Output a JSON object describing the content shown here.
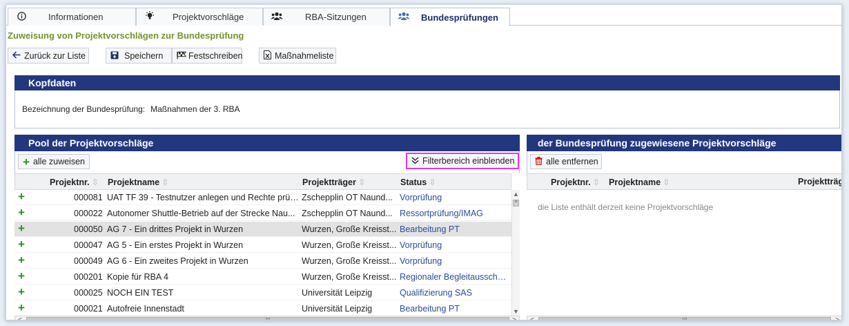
{
  "tabs": [
    {
      "label": "Informationen",
      "icon": "info-icon"
    },
    {
      "label": "Projektvorschläge",
      "icon": "lightbulb-icon"
    },
    {
      "label": "RBA-Sitzungen",
      "icon": "users-icon"
    },
    {
      "label": "Bundesprüfungen",
      "icon": "users-icon",
      "active": true
    }
  ],
  "page_title": "Zuweisung von Projektvorschlägen zur Bundesprüfung",
  "toolbar": {
    "back": "Zurück zur Liste",
    "save": "Speichern",
    "finalize": "Festschreiben",
    "measures": "Maßnahmeliste"
  },
  "kopfdaten": {
    "title": "Kopfdaten",
    "label": "Bezeichnung der Bundesprüfung:",
    "value": "Maßnahmen der 3. RBA"
  },
  "pool": {
    "title": "Pool der Projektvorschläge",
    "assign_all": "alle zuweisen",
    "filter_toggle": "Filterbereich einblenden",
    "columns": [
      "Projektnr.",
      "Projektname",
      "Projektträger",
      "Status"
    ],
    "rows": [
      {
        "nr": "000081",
        "name": "UAT TF 39 - Testnutzer anlegen und Rechte prüf...",
        "traeger": "Zschepplin OT Naund...",
        "status": "Vorprüfung"
      },
      {
        "nr": "000022",
        "name": "Autonomer Shuttle-Betrieb auf der Strecke Nau...",
        "traeger": "Zschepplin OT Naund...",
        "status": "Ressortprüfung/IMAG"
      },
      {
        "nr": "000050",
        "name": "AG 7 - Ein drittes Projekt in Wurzen",
        "traeger": "Wurzen, Große Kreisst...",
        "status": "Bearbeitung PT",
        "selected": true
      },
      {
        "nr": "000047",
        "name": "AG 5 - Ein erstes Projekt in Wurzen",
        "traeger": "Wurzen, Große Kreisst...",
        "status": "Vorprüfung"
      },
      {
        "nr": "000049",
        "name": "AG 6 - Ein zweites Projekt in Wurzen",
        "traeger": "Wurzen, Große Kreisst...",
        "status": "Vorprüfung"
      },
      {
        "nr": "000201",
        "name": "Kopie für RBA 4",
        "traeger": "Wurzen, Große Kreisst...",
        "status": "Regionaler Begleitausschuss"
      },
      {
        "nr": "000025",
        "name": "NOCH EIN TEST",
        "traeger": "Universität Leipzig",
        "status": "Qualifizierung SAS"
      },
      {
        "nr": "000021",
        "name": "Autofreie Innenstadt",
        "traeger": "Universität Leipzig",
        "status": "Bearbeitung PT"
      }
    ]
  },
  "assigned": {
    "title": "der Bundesprüfung zugewiesene Projektvorschläge",
    "remove_all": "alle entfernen",
    "columns": [
      "Projektnr.",
      "Projektname",
      "Projektträg"
    ],
    "empty": "die Liste enthält derzeit keine Projektvorschläge"
  },
  "colors": {
    "header_bg": "#23377f",
    "title_green": "#76922f",
    "status_blue": "#2d4a9c",
    "plus_green": "#2e8b2e",
    "highlight": "#e33ad6"
  }
}
